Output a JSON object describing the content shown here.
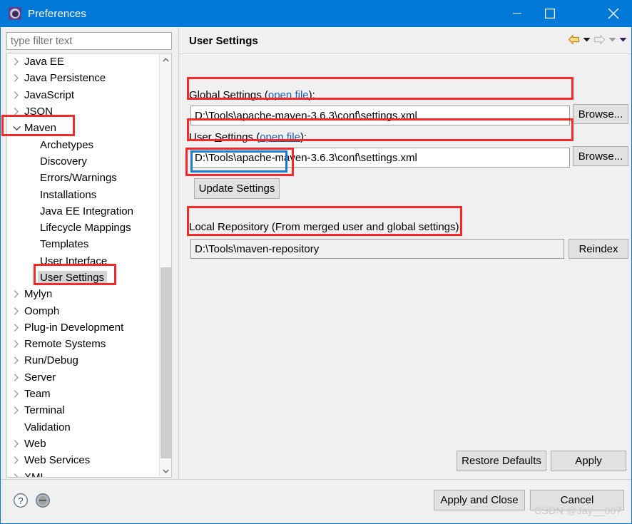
{
  "window": {
    "title": "Preferences",
    "app_icon": "gear-icon",
    "controls": {
      "minimize": "minimize-icon",
      "maximize": "maximize-icon",
      "close": "close-icon"
    }
  },
  "sidebar": {
    "filter": {
      "placeholder": "type filter text",
      "value": ""
    },
    "items": [
      {
        "label": "Java EE",
        "level": 0,
        "expandable": true,
        "expanded": false,
        "selected": false
      },
      {
        "label": "Java Persistence",
        "level": 0,
        "expandable": true,
        "expanded": false,
        "selected": false
      },
      {
        "label": "JavaScript",
        "level": 0,
        "expandable": true,
        "expanded": false,
        "selected": false
      },
      {
        "label": "JSON",
        "level": 0,
        "expandable": true,
        "expanded": false,
        "selected": false
      },
      {
        "label": "Maven",
        "level": 0,
        "expandable": true,
        "expanded": true,
        "selected": false
      },
      {
        "label": "Archetypes",
        "level": 1,
        "expandable": false,
        "expanded": false,
        "selected": false
      },
      {
        "label": "Discovery",
        "level": 1,
        "expandable": false,
        "expanded": false,
        "selected": false
      },
      {
        "label": "Errors/Warnings",
        "level": 1,
        "expandable": false,
        "expanded": false,
        "selected": false
      },
      {
        "label": "Installations",
        "level": 1,
        "expandable": false,
        "expanded": false,
        "selected": false
      },
      {
        "label": "Java EE Integration",
        "level": 1,
        "expandable": false,
        "expanded": false,
        "selected": false
      },
      {
        "label": "Lifecycle Mappings",
        "level": 1,
        "expandable": false,
        "expanded": false,
        "selected": false
      },
      {
        "label": "Templates",
        "level": 1,
        "expandable": false,
        "expanded": false,
        "selected": false
      },
      {
        "label": "User Interface",
        "level": 1,
        "expandable": false,
        "expanded": false,
        "selected": false
      },
      {
        "label": "User Settings",
        "level": 1,
        "expandable": false,
        "expanded": false,
        "selected": true
      },
      {
        "label": "Mylyn",
        "level": 0,
        "expandable": true,
        "expanded": false,
        "selected": false
      },
      {
        "label": "Oomph",
        "level": 0,
        "expandable": true,
        "expanded": false,
        "selected": false
      },
      {
        "label": "Plug-in Development",
        "level": 0,
        "expandable": true,
        "expanded": false,
        "selected": false
      },
      {
        "label": "Remote Systems",
        "level": 0,
        "expandable": true,
        "expanded": false,
        "selected": false
      },
      {
        "label": "Run/Debug",
        "level": 0,
        "expandable": true,
        "expanded": false,
        "selected": false
      },
      {
        "label": "Server",
        "level": 0,
        "expandable": true,
        "expanded": false,
        "selected": false
      },
      {
        "label": "Team",
        "level": 0,
        "expandable": true,
        "expanded": false,
        "selected": false
      },
      {
        "label": "Terminal",
        "level": 0,
        "expandable": true,
        "expanded": false,
        "selected": false
      },
      {
        "label": "Validation",
        "level": 0,
        "expandable": false,
        "expanded": false,
        "selected": false
      },
      {
        "label": "Web",
        "level": 0,
        "expandable": true,
        "expanded": false,
        "selected": false
      },
      {
        "label": "Web Services",
        "level": 0,
        "expandable": true,
        "expanded": false,
        "selected": false
      },
      {
        "label": "XML",
        "level": 0,
        "expandable": true,
        "expanded": false,
        "selected": false
      }
    ]
  },
  "page": {
    "title": "User Settings",
    "nav": {
      "back": "back-arrow-icon",
      "back_menu": "chevron-down-icon",
      "forward": "forward-arrow-icon",
      "forward_menu": "chevron-down-icon",
      "view_menu": "chevron-down-icon"
    },
    "global_settings": {
      "label_prefix": "Global ",
      "label_mnemonic": "S",
      "label_rest": "ettings (",
      "link": "open file",
      "label_suffix": "):",
      "value": "D:\\Tools\\apache-maven-3.6.3\\conf\\settings.xml",
      "browse_label": "Browse..."
    },
    "user_settings": {
      "label_prefix": "User ",
      "label_mnemonic": "S",
      "label_rest": "ettings (",
      "link": "open file",
      "label_suffix": "):",
      "value": "D:\\Tools\\apache-maven-3.6.3\\conf\\settings.xml",
      "browse_label": "Browse...",
      "update_label": "Update Settings"
    },
    "local_repository": {
      "label": "Local Repository (From merged user and global settings):",
      "value": "D:\\Tools\\maven-repository",
      "reindex_label": "Reindex"
    },
    "restore_defaults_label": "Restore Defaults",
    "apply_label": "Apply"
  },
  "footer": {
    "help_icon": "help-circle-icon",
    "restore_icon": "restore-window-icon",
    "apply_and_close_label": "Apply and Close",
    "cancel_label": "Cancel",
    "watermark": "CSDN @Jay__007"
  },
  "colors": {
    "titlebar": "#0078d7",
    "annotation_red": "#f42a2a",
    "annotation_blue": "#1a7ad4",
    "link": "#1a5fb4",
    "selection": "#d4d4d4"
  }
}
